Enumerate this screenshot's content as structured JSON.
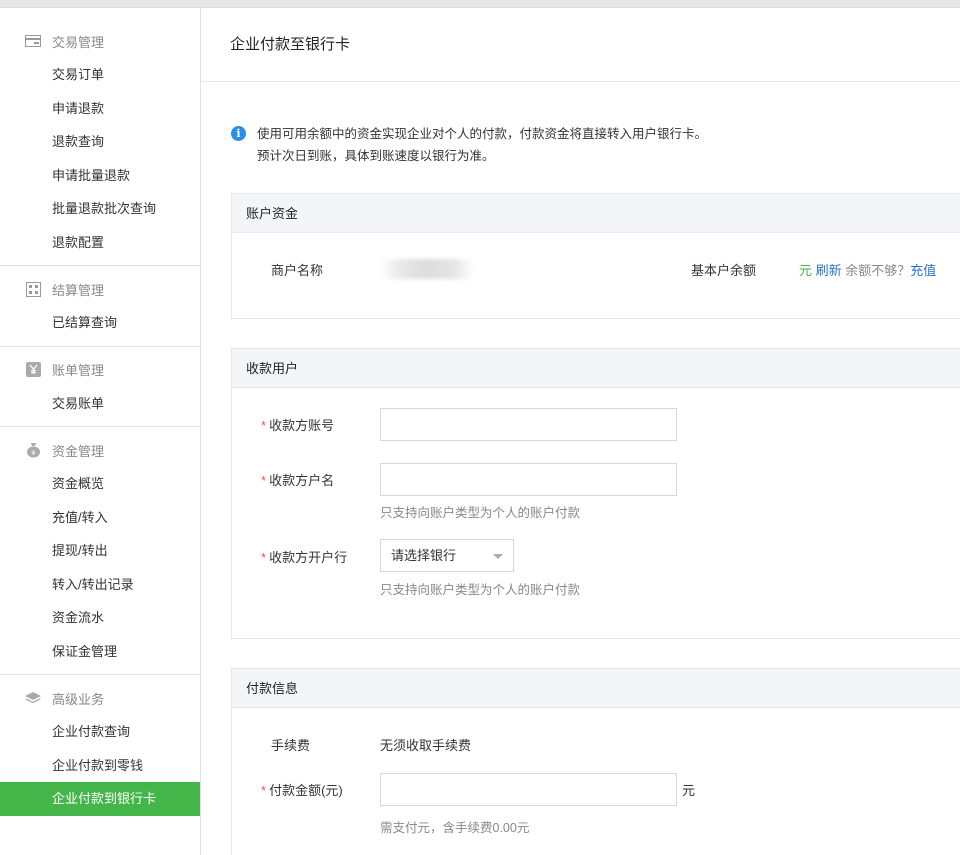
{
  "sidebar": {
    "groups": [
      {
        "title": "交易管理",
        "icon": "credit-card-icon",
        "items": [
          "交易订单",
          "申请退款",
          "退款查询",
          "申请批量退款",
          "批量退款批次查询",
          "退款配置"
        ]
      },
      {
        "title": "结算管理",
        "icon": "settlement-icon",
        "items": [
          "已结算查询"
        ]
      },
      {
        "title": "账单管理",
        "icon": "yen-bill-icon",
        "items": [
          "交易账单"
        ]
      },
      {
        "title": "资金管理",
        "icon": "money-bag-icon",
        "items": [
          "资金概览",
          "充值/转入",
          "提现/转出",
          "转入/转出记录",
          "资金流水",
          "保证金管理"
        ]
      },
      {
        "title": "高级业务",
        "icon": "layers-icon",
        "items": [
          "企业付款查询",
          "企业付款到零钱",
          "企业付款到银行卡"
        ]
      }
    ]
  },
  "page": {
    "title": "企业付款至银行卡",
    "notice_line1": "使用可用余额中的资金实现企业对个人的付款，付款资金将直接转入用户银行卡。",
    "notice_line2": "预计次日到账，具体到账速度以银行为准。"
  },
  "account": {
    "section_title": "账户资金",
    "merchant_label": "商户名称",
    "balance_label": "基本户余额",
    "balance_unit": "元",
    "refresh_link": "刷新",
    "insufficient_text": "余额不够？",
    "recharge_link": "充值"
  },
  "payee": {
    "section_title": "收款用户",
    "required_mark": "*",
    "account_label": "收款方账号",
    "name_label": "收款方户名",
    "name_hint": "只支持向账户类型为个人的账户付款",
    "bank_label": "收款方开户行",
    "bank_select": "请选择银行",
    "bank_hint": "只支持向账户类型为个人的账户付款"
  },
  "payment": {
    "section_title": "付款信息",
    "fee_label": "手续费",
    "fee_value": "无须收取手续费",
    "amount_label": "付款金额(元)",
    "amount_unit": "元",
    "amount_hint": "需支付元，含手续费0.00元"
  },
  "colors": {
    "accent": "#44b549",
    "link": "#2a74c8",
    "info": "#2a8de8",
    "required": "#e15f3f"
  }
}
